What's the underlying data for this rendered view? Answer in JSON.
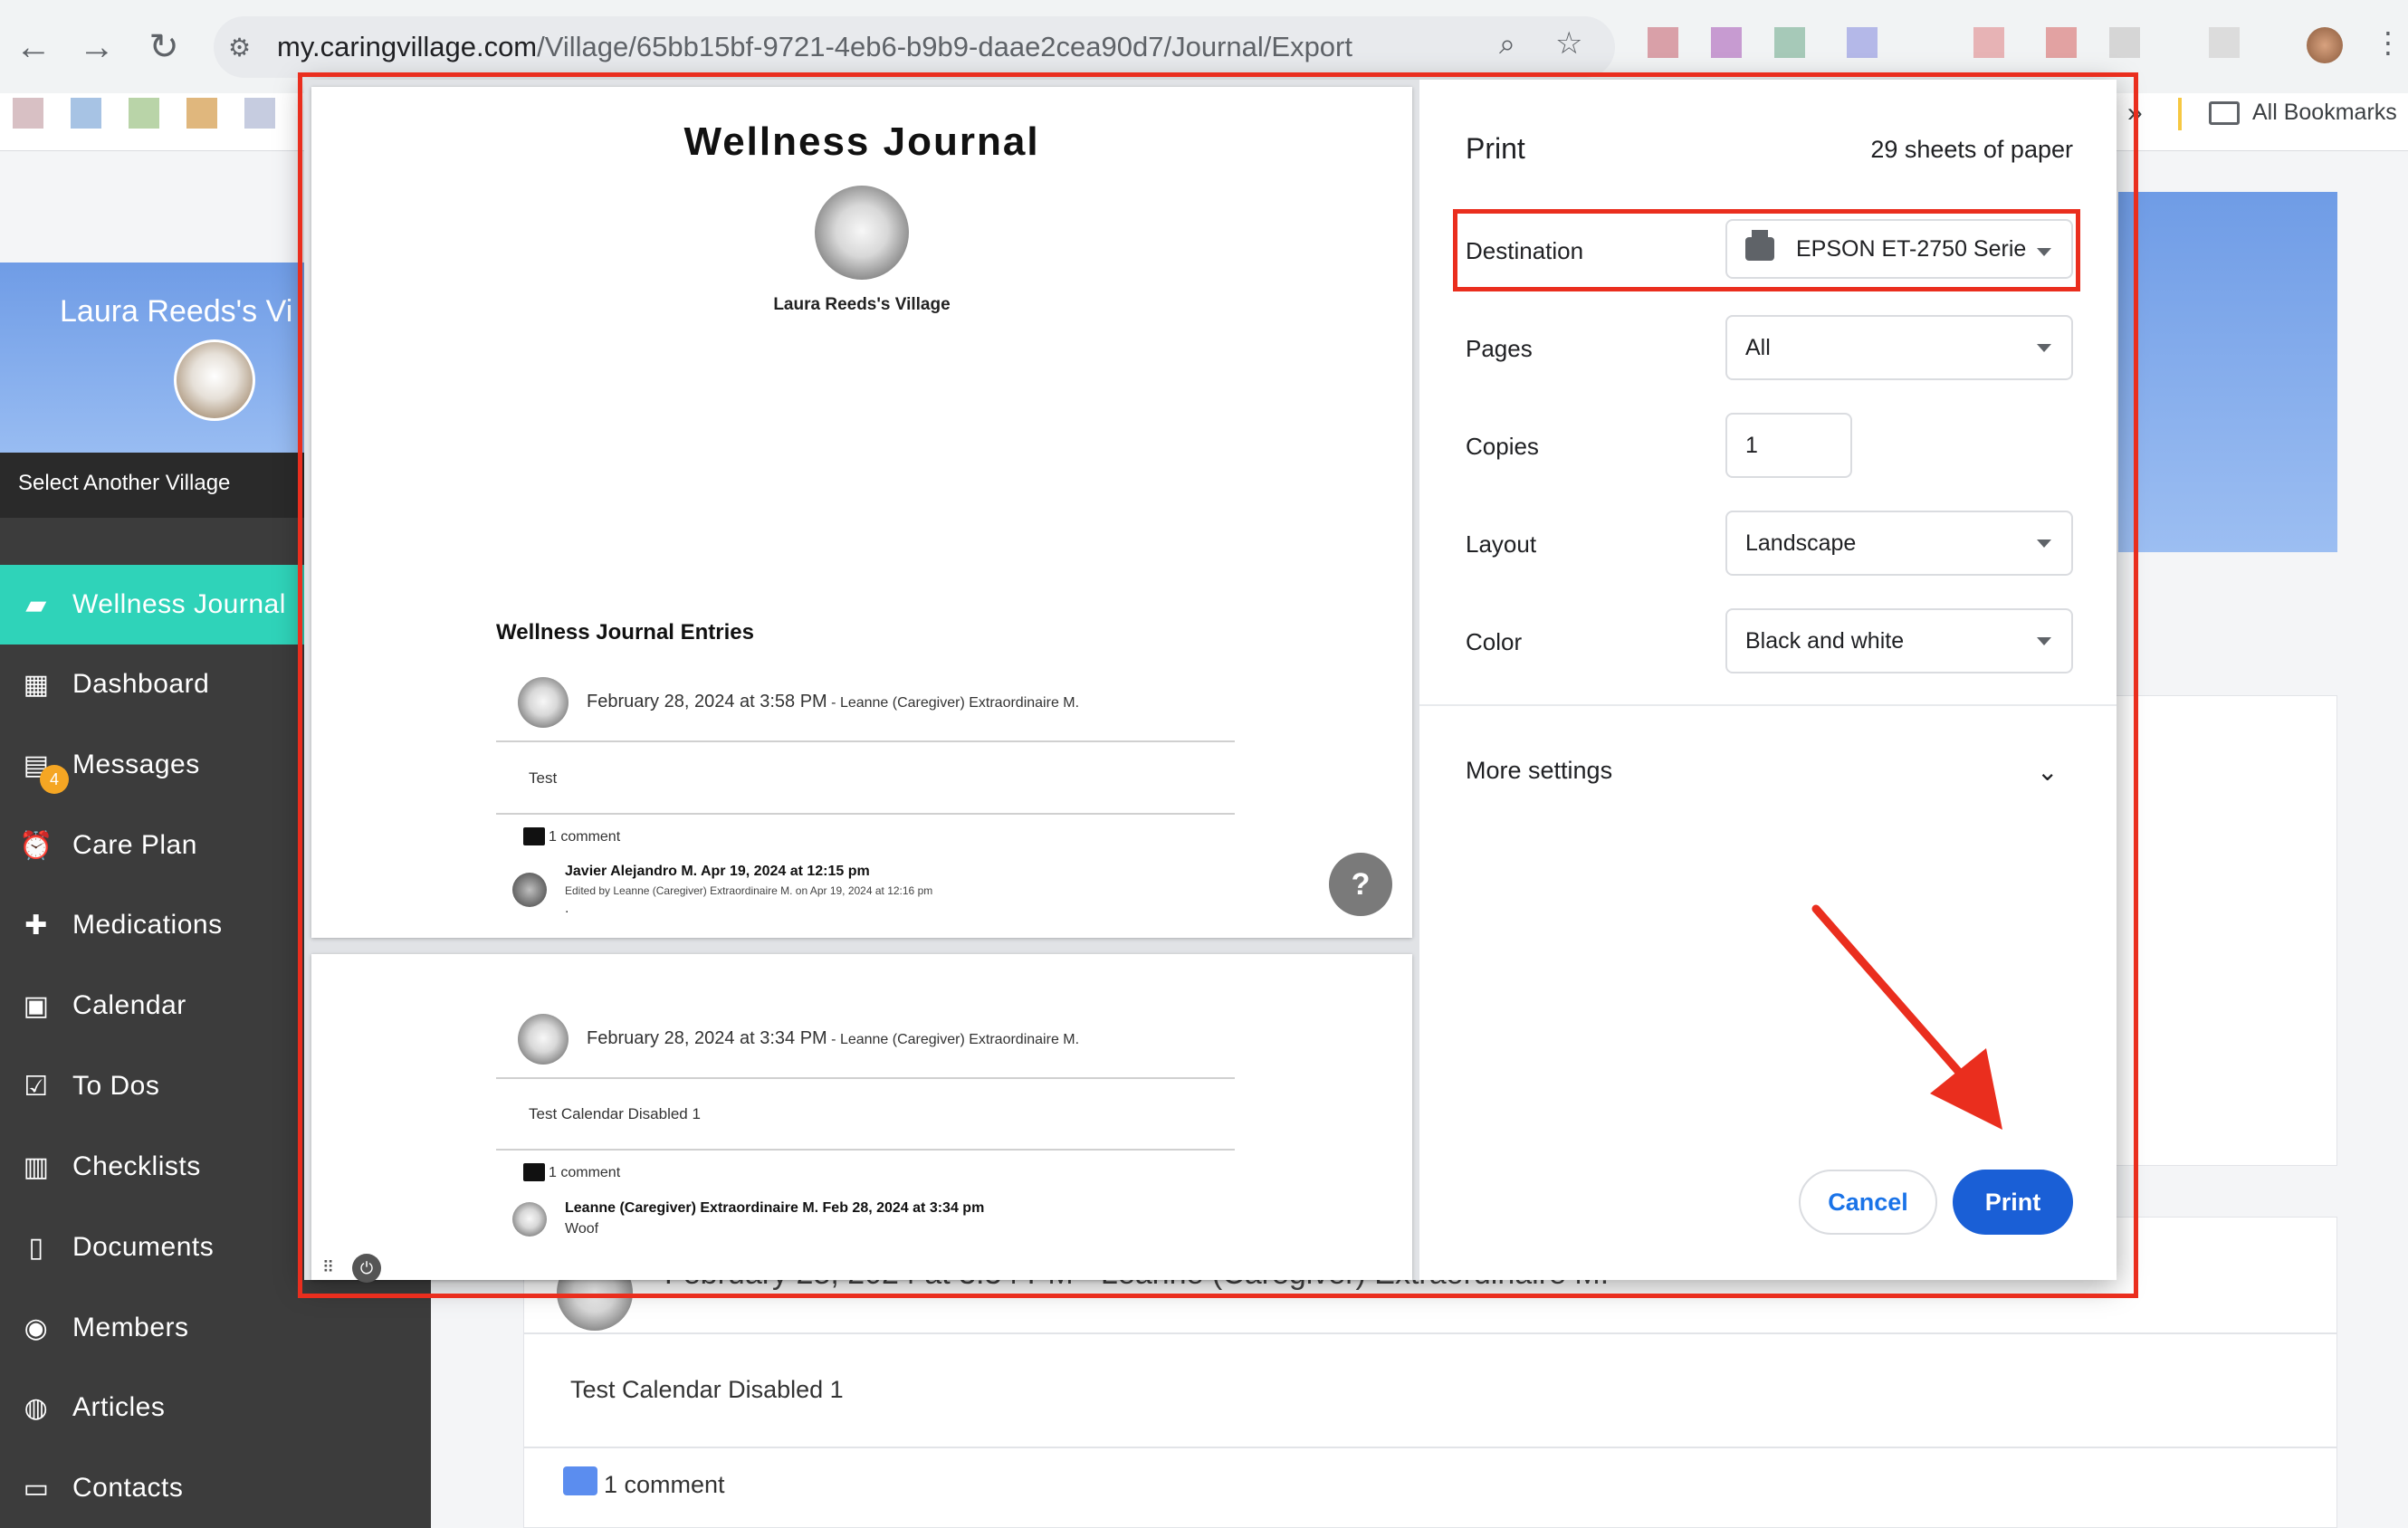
{
  "browser": {
    "url_host": "my.caringvillage.com",
    "url_path": "/Village/65bb15bf-9721-4eb6-b9b9-daae2cea90d7/Journal/Export",
    "all_bookmarks": "All Bookmarks"
  },
  "sidebar": {
    "village_name": "Laura Reeds's Vi",
    "select_another": "Select Another Village",
    "messages_badge": "4",
    "items": [
      {
        "label": "Wellness Journal",
        "icon": "journal-icon"
      },
      {
        "label": "Dashboard",
        "icon": "dashboard-icon"
      },
      {
        "label": "Messages",
        "icon": "messages-icon"
      },
      {
        "label": "Care Plan",
        "icon": "alarm-icon"
      },
      {
        "label": "Medications",
        "icon": "plus-icon"
      },
      {
        "label": "Calendar",
        "icon": "calendar-icon"
      },
      {
        "label": "To Dos",
        "icon": "checkbox-icon"
      },
      {
        "label": "Checklists",
        "icon": "clipboard-icon"
      },
      {
        "label": "Documents",
        "icon": "document-icon"
      },
      {
        "label": "Members",
        "icon": "person-icon"
      },
      {
        "label": "Articles",
        "icon": "globe-icon"
      },
      {
        "label": "Contacts",
        "icon": "contact-card-icon"
      }
    ]
  },
  "background_entry": {
    "date_line": "February 28, 2024 at 3:34 PM - Leanne (Caregiver) Extraordinaire M.",
    "body": "Test Calendar Disabled 1",
    "comments": "1 comment"
  },
  "preview": {
    "title": "Wellness Journal",
    "village": "Laura Reeds's Village",
    "entries_heading": "Wellness Journal Entries",
    "entries": [
      {
        "date": "February 28, 2024 at 3:58 PM",
        "author": " - Leanne (Caregiver) Extraordinaire M.",
        "text": "Test",
        "comments": "1 comment",
        "commenter": "Javier Alejandro M. Apr 19, 2024 at 12:15 pm",
        "edited": "Edited by Leanne (Caregiver) Extraordinaire M. on Apr 19, 2024 at 12:16 pm",
        "comment_text": "."
      },
      {
        "date": "February 28, 2024 at 3:34 PM",
        "author": " - Leanne (Caregiver) Extraordinaire M.",
        "text": "Test Calendar Disabled 1",
        "comments": "1 comment",
        "commenter": "Leanne (Caregiver) Extraordinaire M. Feb 28, 2024 at 3:34 pm",
        "comment_text": "Woof"
      }
    ]
  },
  "print": {
    "title": "Print",
    "sheets": "29 sheets of paper",
    "destination_label": "Destination",
    "destination_value": "EPSON ET-2750 Serie",
    "pages_label": "Pages",
    "pages_value": "All",
    "copies_label": "Copies",
    "copies_value": "1",
    "layout_label": "Layout",
    "layout_value": "Landscape",
    "color_label": "Color",
    "color_value": "Black and white",
    "more_settings": "More settings",
    "cancel": "Cancel",
    "print": "Print"
  },
  "colors": {
    "annotation_red": "#ea2e1e",
    "accent_teal": "#2fd3b9",
    "print_blue": "#1a5fd6"
  }
}
